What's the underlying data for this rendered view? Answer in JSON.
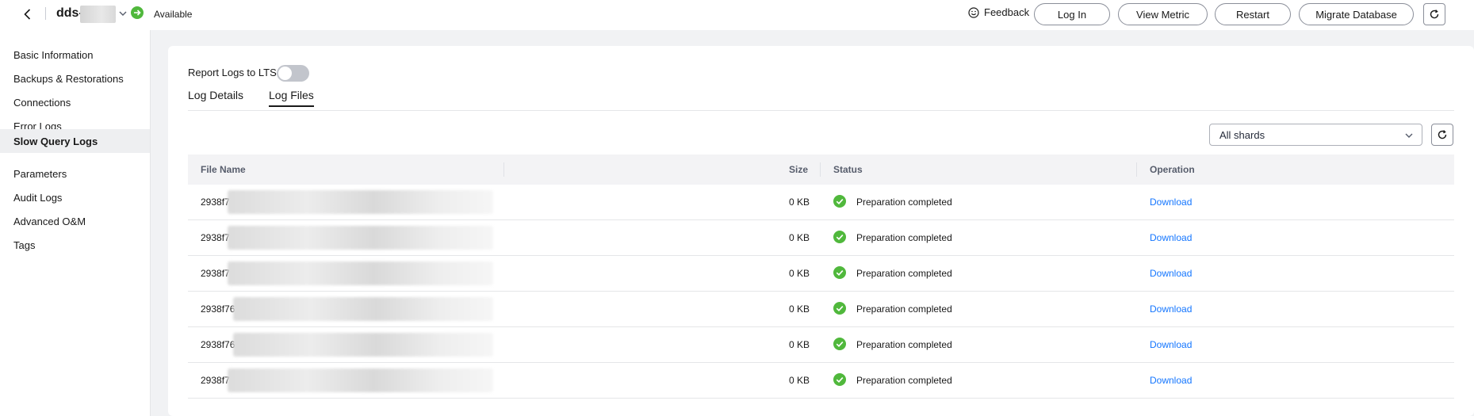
{
  "header": {
    "instance_name": "dds-",
    "status": "Available",
    "feedback": "Feedback",
    "buttons": [
      "Log In",
      "View Metric",
      "Restart",
      "Migrate Database"
    ]
  },
  "sidebar": {
    "items": [
      {
        "label": "Basic Information"
      },
      {
        "label": "Backups & Restorations"
      },
      {
        "label": "Connections"
      },
      {
        "label": "Error Logs"
      },
      {
        "label": "Slow Query Logs",
        "active": true
      },
      {
        "label": "Parameters"
      },
      {
        "label": "Audit Logs"
      },
      {
        "label": "Advanced O&M"
      },
      {
        "label": "Tags"
      }
    ]
  },
  "main": {
    "report_logs_label": "Report Logs to LTS",
    "report_logs_enabled": false,
    "tabs": [
      {
        "label": "Log Details",
        "active": false
      },
      {
        "label": "Log Files",
        "active": true
      }
    ],
    "shard_select": "All shards",
    "table": {
      "columns": [
        "File Name",
        "Size",
        "Status",
        "Operation"
      ],
      "rows": [
        {
          "file_prefix": "2938f7",
          "size": "0 KB",
          "status": "Preparation completed",
          "operation": "Download"
        },
        {
          "file_prefix": "2938f7",
          "size": "0 KB",
          "status": "Preparation completed",
          "operation": "Download"
        },
        {
          "file_prefix": "2938f7",
          "size": "0 KB",
          "status": "Preparation completed",
          "operation": "Download"
        },
        {
          "file_prefix": "2938f76",
          "size": "0 KB",
          "status": "Preparation completed",
          "operation": "Download"
        },
        {
          "file_prefix": "2938f76",
          "size": "0 KB",
          "status": "Preparation completed",
          "operation": "Download"
        },
        {
          "file_prefix": "2938f7",
          "size": "0 KB",
          "status": "Preparation completed",
          "operation": "Download"
        }
      ]
    }
  },
  "colors": {
    "accent_link": "#1476ff",
    "status_ok": "#50b83c",
    "toggle_off": "#c2c5cc"
  },
  "icons": [
    "back-arrow-icon",
    "chevron-down-icon",
    "status-available-icon",
    "smile-icon",
    "refresh-icon",
    "check-circle-icon"
  ]
}
